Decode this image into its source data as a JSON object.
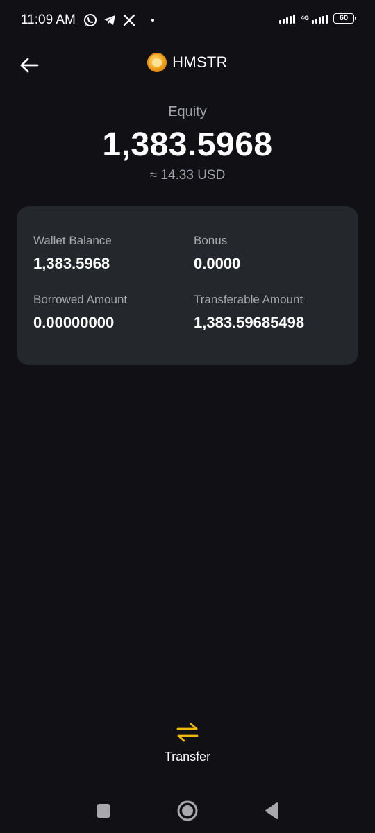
{
  "status_bar": {
    "time": "11:09 AM",
    "network": "4G",
    "battery": "60"
  },
  "header": {
    "title": "HMSTR"
  },
  "equity": {
    "label": "Equity",
    "value": "1,383.5968",
    "usd": "≈ 14.33 USD"
  },
  "card": {
    "wallet_balance_label": "Wallet Balance",
    "wallet_balance_value": "1,383.5968",
    "bonus_label": "Bonus",
    "bonus_value": "0.0000",
    "borrowed_label": "Borrowed Amount",
    "borrowed_value": "0.00000000",
    "transferable_label": "Transferable Amount",
    "transferable_value": "1,383.59685498"
  },
  "actions": {
    "transfer_label": "Transfer"
  },
  "colors": {
    "background": "#111115",
    "card": "#24272b",
    "accent": "#f0b90b",
    "muted_text": "#a0a3a9"
  },
  "icons": {
    "back": "arrow-left-icon",
    "coin": "hmstr-coin-icon",
    "transfer": "swap-arrows-icon"
  }
}
